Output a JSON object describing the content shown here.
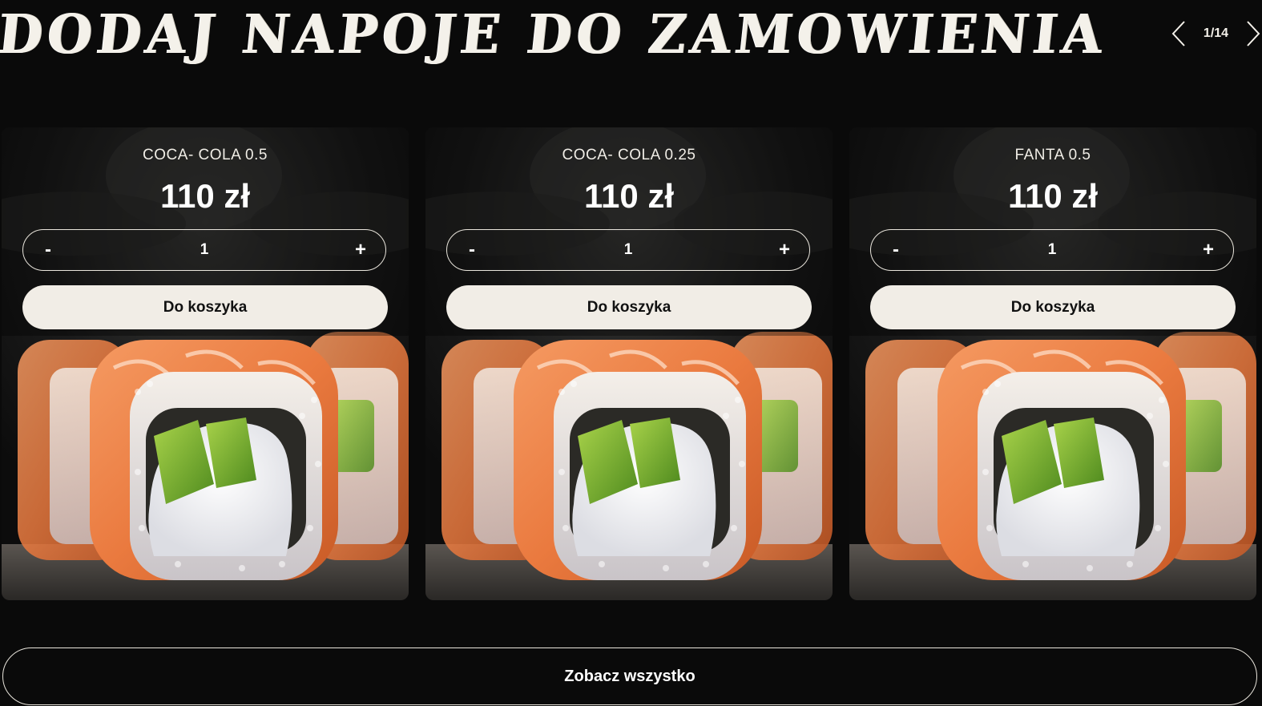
{
  "header": {
    "title": "DODAJ NAPOJE DO ZAMOWIENIA",
    "pager_text": "1/14"
  },
  "icons": {
    "prev": "chevron-left-icon",
    "next": "chevron-right-icon",
    "image": "sushi-roll-photo"
  },
  "colors": {
    "background": "#0a0a0a",
    "button_bg": "#f1ede6",
    "text": "#ffffff"
  },
  "products": [
    {
      "name": "COCA- COLA 0.5",
      "price": "110 zł",
      "minus_label": "-",
      "quantity": "1",
      "plus_label": "+",
      "add_label": "Do koszyka"
    },
    {
      "name": "COCA- COLA 0.25",
      "price": "110 zł",
      "minus_label": "-",
      "quantity": "1",
      "plus_label": "+",
      "add_label": "Do koszyka"
    },
    {
      "name": "FANTA 0.5",
      "price": "110 zł",
      "minus_label": "-",
      "quantity": "1",
      "plus_label": "+",
      "add_label": "Do koszyka"
    }
  ],
  "footer": {
    "see_all_label": "Zobacz wszystko"
  }
}
